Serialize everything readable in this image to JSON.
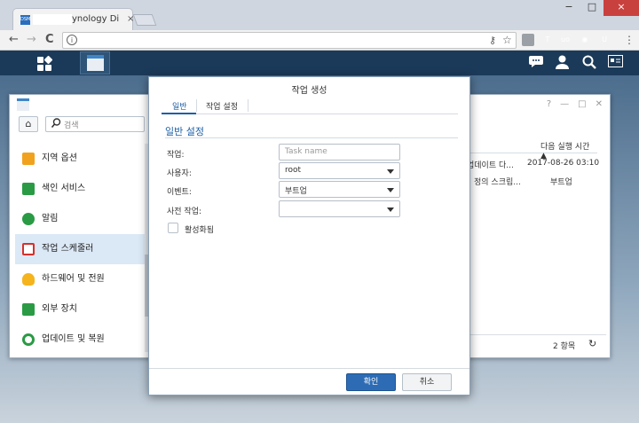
{
  "browser": {
    "tab_title": "ynology Di",
    "favicon_text": "DSM",
    "tab_close": "×",
    "window_min": "−",
    "window_max": "□",
    "window_close": "×",
    "nav_back": "←",
    "nav_forward": "→",
    "nav_reload": "C",
    "info_icon": "i",
    "key_icon": "⚷",
    "star_icon": "☆",
    "menu_icon": "⋮",
    "extensions": [
      {
        "name": "ext-t",
        "label": "T",
        "color": "#9aa0a6"
      },
      {
        "name": "ext-ublock",
        "label": "uo",
        "color": "#b01d1d"
      },
      {
        "name": "ext-chrome",
        "label": "◉",
        "color": "#2e9e44"
      },
      {
        "name": "ext-u",
        "label": "U",
        "color": "#444444"
      }
    ]
  },
  "dsm": {
    "chat_icon": "💬",
    "user_icon": "👤",
    "search_icon": "⌕",
    "notes_icon": "▤"
  },
  "control_panel": {
    "home_icon": "⌂",
    "search_icon": "⚲",
    "search_placeholder": "검색",
    "window_help": "?",
    "window_min": "—",
    "window_max": "□",
    "window_close": "✕",
    "sidebar": [
      {
        "label": "지역 옵션",
        "name": "region-options",
        "color": "#f0a21e",
        "active": false
      },
      {
        "label": "색인 서비스",
        "name": "index-service",
        "color": "#2a9b44",
        "active": false
      },
      {
        "label": "알림",
        "name": "notification",
        "color": "#2a9b44",
        "active": false
      },
      {
        "label": "작업 스케줄러",
        "name": "task-scheduler",
        "color": "#d6302a",
        "active": true
      },
      {
        "label": "하드웨어 및 전원",
        "name": "hardware-power",
        "color": "#f5b41b",
        "active": false
      },
      {
        "label": "외부 장치",
        "name": "external-devices",
        "color": "#2a9b44",
        "active": false
      },
      {
        "label": "업데이트 및 복원",
        "name": "update-restore",
        "color": "#2a9b44",
        "active": false
      }
    ],
    "table": {
      "header": "다음 실행 시간 ▲",
      "row1_col1": "업데이트 다...",
      "row1_col2": "2017-08-26 03:10",
      "row2_col1": "정의 스크립...",
      "row2_col2": "부트업"
    },
    "footer_count": "2 항목",
    "refresh_icon": "↻"
  },
  "dialog": {
    "title": "작업 생성",
    "tab_general": "일반",
    "tab_settings": "작업 설정",
    "section_title": "일반 설정",
    "task_label": "작업:",
    "task_placeholder": "Task name",
    "user_label": "사용자:",
    "user_value": "root",
    "event_label": "이벤트:",
    "event_value": "부트업",
    "pretask_label": "사전 작업:",
    "pretask_value": "",
    "enabled_label": "활성화됨",
    "ok_label": "확인",
    "cancel_label": "취소"
  }
}
